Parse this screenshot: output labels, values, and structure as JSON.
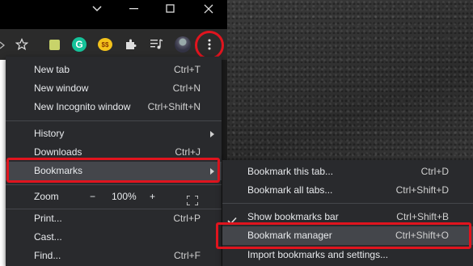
{
  "window": {
    "controls": [
      "chevron-down",
      "minimize",
      "maximize",
      "close"
    ]
  },
  "toolbar": {
    "icons": [
      "star-icon",
      "extension-square-icon",
      "grammarly-icon",
      "coupon-extension-icon",
      "puzzle-icon",
      "media-queue-icon",
      "profile-avatar",
      "more-menu-icon"
    ]
  },
  "menu": {
    "new_tab": {
      "label": "New tab",
      "shortcut": "Ctrl+T"
    },
    "new_window": {
      "label": "New window",
      "shortcut": "Ctrl+N"
    },
    "new_incognito": {
      "label": "New Incognito window",
      "shortcut": "Ctrl+Shift+N"
    },
    "history": {
      "label": "History"
    },
    "downloads": {
      "label": "Downloads",
      "shortcut": "Ctrl+J"
    },
    "bookmarks": {
      "label": "Bookmarks"
    },
    "zoom": {
      "label": "Zoom",
      "minus": "−",
      "value": "100%",
      "plus": "+"
    },
    "print": {
      "label": "Print...",
      "shortcut": "Ctrl+P"
    },
    "cast": {
      "label": "Cast..."
    },
    "find": {
      "label": "Find...",
      "shortcut": "Ctrl+F"
    }
  },
  "submenu": {
    "bookmark_tab": {
      "label": "Bookmark this tab...",
      "shortcut": "Ctrl+D"
    },
    "bookmark_all": {
      "label": "Bookmark all tabs...",
      "shortcut": "Ctrl+Shift+D"
    },
    "show_bar": {
      "label": "Show bookmarks bar",
      "shortcut": "Ctrl+Shift+B",
      "checked": true
    },
    "manager": {
      "label": "Bookmark manager",
      "shortcut": "Ctrl+Shift+O"
    },
    "import": {
      "label": "Import bookmarks and settings..."
    }
  },
  "colors": {
    "highlight_red": "#e0141e",
    "menu_bg": "#292a2d",
    "hover_bg": "#44464b"
  }
}
